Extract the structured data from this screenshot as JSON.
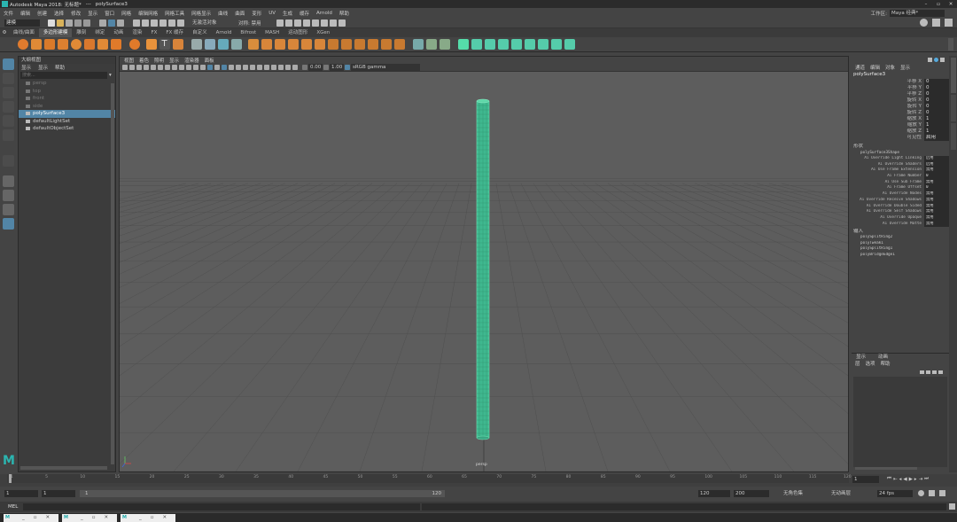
{
  "app": {
    "title": "Autodesk Maya 2018: 无标题*",
    "sep": "---",
    "object": "polySurface3",
    "workspace_label": "工作区:",
    "workspace_value": "Maya 经典*"
  },
  "menu": [
    "文件",
    "编辑",
    "创建",
    "选择",
    "修改",
    "显示",
    "窗口",
    "网格",
    "编辑网格",
    "网格工具",
    "网格显示",
    "曲线",
    "曲面",
    "变形",
    "UV",
    "生成",
    "缓存",
    "Arnold",
    "帮助"
  ],
  "status": {
    "mode": "建模",
    "live_surface": "无激活对象",
    "symmetry": "对称: 禁用"
  },
  "shelf_tabs": [
    {
      "label": "曲线/曲面",
      "active": false
    },
    {
      "label": "多边形建模",
      "active": true
    },
    {
      "label": "雕刻",
      "active": false
    },
    {
      "label": "绑定",
      "active": false
    },
    {
      "label": "动画",
      "active": false
    },
    {
      "label": "渲染",
      "active": false
    },
    {
      "label": "FX",
      "active": false
    },
    {
      "label": "FX 缓存",
      "active": false
    },
    {
      "label": "自定义",
      "active": false
    },
    {
      "label": "Arnold",
      "active": false
    },
    {
      "label": "Bifrost",
      "active": false
    },
    {
      "label": "MASH",
      "active": false
    },
    {
      "label": "运动图形",
      "active": false
    },
    {
      "label": "XGen",
      "active": false
    }
  ],
  "outliner": {
    "title": "大纲视图",
    "menu": [
      "显示",
      "显示",
      "帮助"
    ],
    "search_placeholder": "搜索...",
    "items": [
      {
        "label": "persp",
        "dim": true,
        "selected": false
      },
      {
        "label": "top",
        "dim": true,
        "selected": false
      },
      {
        "label": "front",
        "dim": true,
        "selected": false
      },
      {
        "label": "side",
        "dim": true,
        "selected": false
      },
      {
        "label": "polySurface3",
        "dim": false,
        "selected": true
      },
      {
        "label": "defaultLightSet",
        "dim": false,
        "selected": false
      },
      {
        "label": "defaultObjectSet",
        "dim": false,
        "selected": false
      }
    ]
  },
  "viewport": {
    "menu": [
      "视图",
      "着色",
      "照明",
      "显示",
      "渲染器",
      "面板"
    ],
    "val1": "0.00",
    "val2": "1.00",
    "colorspace": "sRGB gamma",
    "camera": "persp"
  },
  "attr": {
    "tabs": [
      "通道",
      "编辑",
      "对象",
      "显示"
    ],
    "object": "polySurface3",
    "transforms": [
      {
        "label": "平移 X",
        "value": "0"
      },
      {
        "label": "平移 Y",
        "value": "0"
      },
      {
        "label": "平移 Z",
        "value": "0"
      },
      {
        "label": "旋转 X",
        "value": "0"
      },
      {
        "label": "旋转 Y",
        "value": "0"
      },
      {
        "label": "旋转 Z",
        "value": "0"
      },
      {
        "label": "缩放 X",
        "value": "1"
      },
      {
        "label": "缩放 Y",
        "value": "1"
      },
      {
        "label": "缩放 Z",
        "value": "1"
      },
      {
        "label": "可见性",
        "value": "启用"
      }
    ],
    "shapes_header": "形状",
    "shape_name": "polySurface3Shape",
    "shape_rows": [
      {
        "label": "Ai Override Light Linking",
        "value": "启用"
      },
      {
        "label": "Ai Override Shaders",
        "value": "启用"
      },
      {
        "label": "Ai Use Frame Extension",
        "value": "禁用"
      },
      {
        "label": "Ai Frame Number",
        "value": "0"
      },
      {
        "label": "Ai Use Sub Frame",
        "value": "禁用"
      },
      {
        "label": "Ai Frame Offset",
        "value": "0"
      },
      {
        "label": "Ai Override Nodes",
        "value": "禁用"
      },
      {
        "label": "Ai Override Receive Shadows",
        "value": "禁用"
      },
      {
        "label": "Ai Override Double Sided",
        "value": "禁用"
      },
      {
        "label": "Ai Override Self Shadows",
        "value": "禁用"
      },
      {
        "label": "Ai Override Opaque",
        "value": "禁用"
      },
      {
        "label": "Ai Override Matte",
        "value": "禁用"
      }
    ],
    "inputs_header": "输入",
    "inputs": [
      "polySplitRing2",
      "polyTweak1",
      "polySplitRing1",
      "polyBridgeEdge1"
    ],
    "layer_tabs": [
      "显示",
      "动画"
    ],
    "layer_menu": [
      "层",
      "选项",
      "帮助"
    ]
  },
  "timeline": {
    "ticks": [
      "1",
      "5",
      "10",
      "15",
      "20",
      "25",
      "30",
      "35",
      "40",
      "45",
      "50",
      "55",
      "60",
      "65",
      "70",
      "75",
      "80",
      "85",
      "90",
      "95",
      "100",
      "105",
      "110",
      "115",
      "120"
    ],
    "current": "1"
  },
  "range": {
    "start": "1",
    "start2": "1",
    "inner_start": "1",
    "inner_end": "120",
    "end1": "120",
    "end2": "200",
    "char_set": "无角色集",
    "anim_layer": "无动画层",
    "fps": "24 fps"
  },
  "cmd": {
    "label": "MEL"
  },
  "taskbar": [
    {
      "label": "M"
    },
    {
      "label": "M"
    },
    {
      "label": "M"
    }
  ]
}
